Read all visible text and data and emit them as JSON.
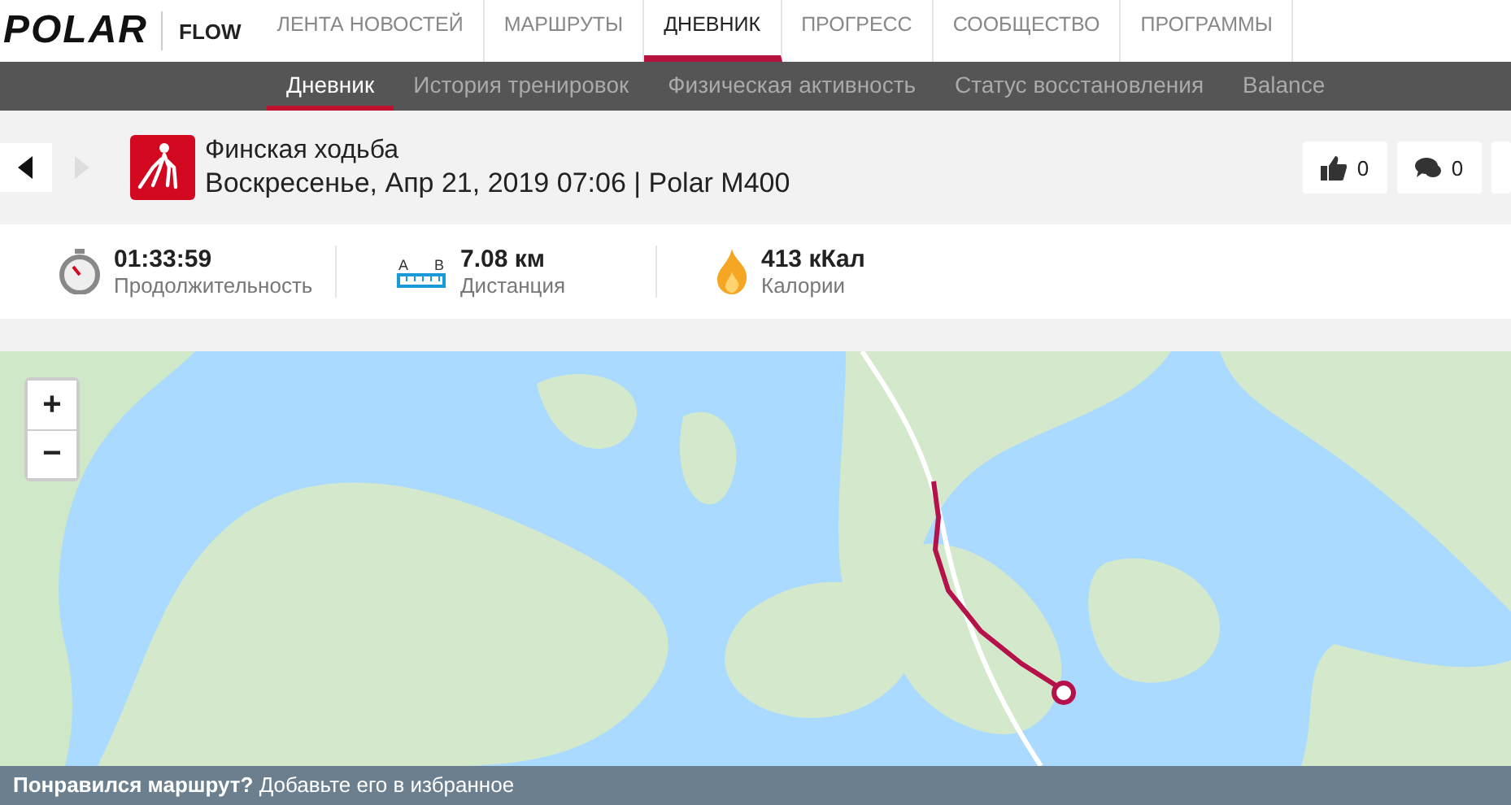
{
  "top_nav": {
    "logo": "POLAR",
    "brand": "FLOW",
    "items": [
      {
        "label": "ЛЕНТА НОВОСТЕЙ",
        "selected": false
      },
      {
        "label": "МАРШРУТЫ",
        "selected": false
      },
      {
        "label": "ДНЕВНИК",
        "selected": true
      },
      {
        "label": "ПРОГРЕСС",
        "selected": false
      },
      {
        "label": "СООБЩЕСТВО",
        "selected": false
      },
      {
        "label": "ПРОГРАММЫ",
        "selected": false
      }
    ]
  },
  "sub_nav": {
    "items": [
      {
        "label": "Дневник",
        "selected": true
      },
      {
        "label": "История тренировок",
        "selected": false
      },
      {
        "label": "Физическая активность",
        "selected": false
      },
      {
        "label": "Статус восстановления",
        "selected": false
      },
      {
        "label": "Balance",
        "selected": false
      }
    ]
  },
  "session": {
    "prev_disabled": false,
    "next_disabled": true,
    "title": "Финская ходьба",
    "subtitle": "Воскресенье, Апр 21, 2019 07:06 | Polar M400",
    "likes": "0",
    "comments": "0"
  },
  "stats": [
    {
      "kind": "duration",
      "value": "01:33:59",
      "label": "Продолжительность"
    },
    {
      "kind": "distance",
      "value": "7.08 км",
      "label": "Дистанция",
      "icon_letters": [
        "A",
        "B"
      ]
    },
    {
      "kind": "calories",
      "value": "413 кКал",
      "label": "Калории"
    }
  ],
  "map": {
    "zoom_in": "+",
    "zoom_out": "−"
  },
  "banner": {
    "text": "**Понравился маршрут?** Добавьте его в избранное"
  }
}
